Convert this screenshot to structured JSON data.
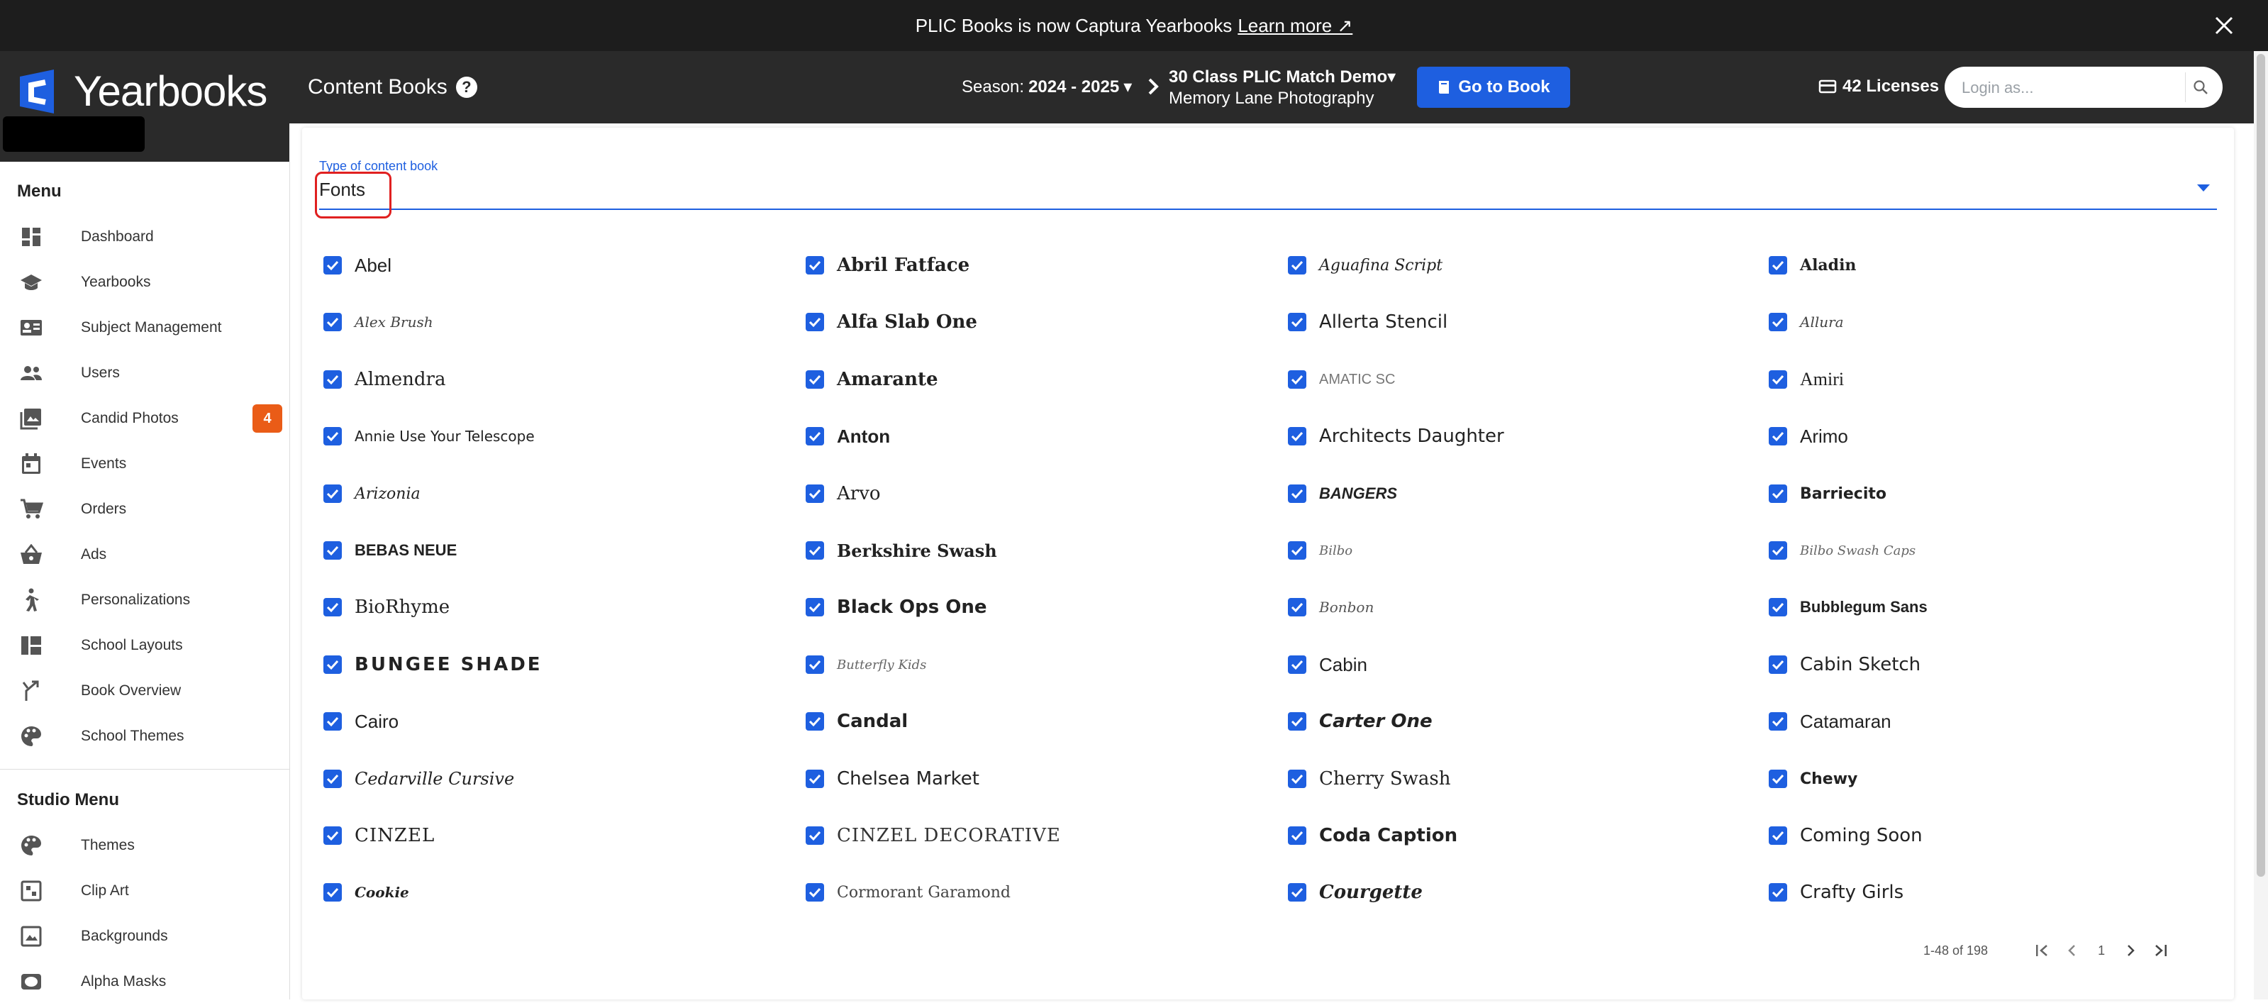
{
  "banner": {
    "text": "PLIC Books is now Captura Yearbooks",
    "link": "Learn more ↗",
    "close_icon": "close-icon"
  },
  "brand": {
    "logo_text": "Yearbooks",
    "logo_color": "#1e5fe0"
  },
  "header": {
    "title": "Content Books",
    "season_label": "Season:",
    "season_value": "2024 - 2025",
    "book_name": "30 Class PLIC Match Demo",
    "book_studio": "Memory Lane Photography",
    "go_to_book": "Go to Book",
    "licenses": "42 Licenses",
    "login_placeholder": "Login as..."
  },
  "sidebar": {
    "menu_heading": "Menu",
    "items": [
      {
        "label": "Dashboard",
        "icon": "dashboard-icon"
      },
      {
        "label": "Yearbooks",
        "icon": "graduation-cap-icon"
      },
      {
        "label": "Subject Management",
        "icon": "id-card-icon"
      },
      {
        "label": "Users",
        "icon": "users-icon"
      },
      {
        "label": "Candid Photos",
        "icon": "photos-icon",
        "badge": "4"
      },
      {
        "label": "Events",
        "icon": "calendar-icon"
      },
      {
        "label": "Orders",
        "icon": "cart-icon"
      },
      {
        "label": "Ads",
        "icon": "basket-icon"
      },
      {
        "label": "Personalizations",
        "icon": "person-walking-icon"
      },
      {
        "label": "School Layouts",
        "icon": "layout-icon"
      },
      {
        "label": "Book Overview",
        "icon": "merge-arrow-icon"
      },
      {
        "label": "School Themes",
        "icon": "palette-icon"
      }
    ],
    "studio_heading": "Studio Menu",
    "studio_items": [
      {
        "label": "Themes",
        "icon": "palette-icon"
      },
      {
        "label": "Clip Art",
        "icon": "clipart-icon"
      },
      {
        "label": "Backgrounds",
        "icon": "background-icon"
      },
      {
        "label": "Alpha Masks",
        "icon": "mask-icon"
      }
    ]
  },
  "content": {
    "type_label": "Type of content book",
    "type_value": "Fonts",
    "fonts": [
      "Abel",
      "Abril Fatface",
      "Aguafina Script",
      "Aladin",
      "Alex Brush",
      "Alfa Slab One",
      "Allerta Stencil",
      "Allura",
      "Almendra",
      "Amarante",
      "AMATIC SC",
      "Amiri",
      "Annie Use Your Telescope",
      "Anton",
      "Architects Daughter",
      "Arimo",
      "Arizonia",
      "Arvo",
      "BANGERS",
      "Barriecito",
      "BEBAS NEUE",
      "Berkshire Swash",
      "Bilbo",
      "Bilbo Swash Caps",
      "BioRhyme",
      "Black Ops One",
      "Bonbon",
      "Bubblegum Sans",
      "BUNGEE SHADE",
      "Butterfly Kids",
      "Cabin",
      "Cabin Sketch",
      "Cairo",
      "Candal",
      "Carter One",
      "Catamaran",
      "Cedarville Cursive",
      "Chelsea Market",
      "Cherry Swash",
      "Chewy",
      "CINZEL",
      "CINZEL DECORATIVE",
      "Coda Caption",
      "Coming Soon",
      "Cookie",
      "Cormorant Garamond",
      "Courgette",
      "Crafty Girls"
    ],
    "checkbox_color": "#1e5fe0"
  },
  "pager": {
    "range": "1-48 of 198",
    "page": "1"
  }
}
